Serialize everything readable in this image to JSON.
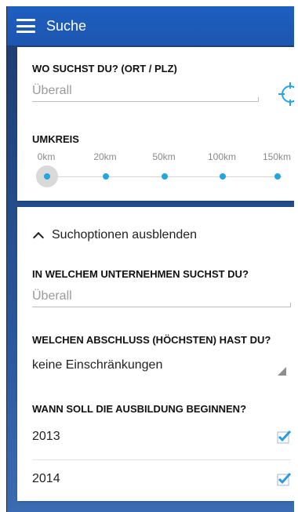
{
  "appbar": {
    "title": "Suche",
    "menu_icon": "menu-icon"
  },
  "location": {
    "label": "WO SUCHST DU? (ORT / PLZ)",
    "placeholder": "Überall",
    "locate_icon": "crosshair-icon"
  },
  "radius": {
    "label": "UMKREIS",
    "options": [
      "0km",
      "20km",
      "50km",
      "100km",
      "150km"
    ],
    "selected": "0km"
  },
  "options_toggle": {
    "label": "Suchoptionen ausblenden",
    "icon": "chevron-up-icon"
  },
  "company": {
    "label": "IN WELCHEM UNTERNEHMEN SUCHST DU?",
    "placeholder": "Überall"
  },
  "degree": {
    "label": "WELCHEN ABSCHLUSS (HÖCHSTEN) HAST DU?",
    "value": "keine Einschränkungen"
  },
  "start": {
    "label": "WANN SOLL DIE AUSBILDUNG BEGINNEN?",
    "years": [
      {
        "year": "2013",
        "checked": true
      },
      {
        "year": "2014",
        "checked": true
      }
    ]
  },
  "colors": {
    "accent": "#23a6e0",
    "appbar": "#1f5fc0",
    "check": "#2b9be0"
  }
}
